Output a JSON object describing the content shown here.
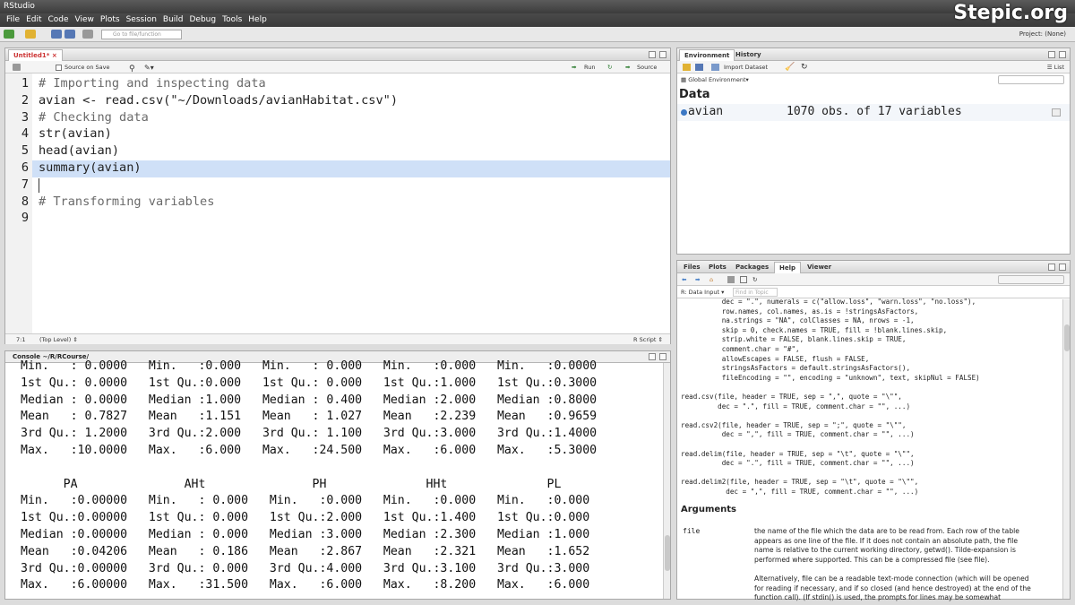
{
  "app": {
    "title": "RStudio",
    "brand": "Stepic.org"
  },
  "menu": [
    "File",
    "Edit",
    "Code",
    "View",
    "Plots",
    "Session",
    "Build",
    "Debug",
    "Tools",
    "Help"
  ],
  "toolbar": {
    "goto_placeholder": "Go to file/function",
    "project": "Project: (None)"
  },
  "editor": {
    "tab": "Untitled1*",
    "source_on_save": "Source on Save",
    "run": "Run",
    "source": "Source",
    "lines": [
      {
        "n": "1",
        "text": "# Importing and inspecting data",
        "kind": "comment"
      },
      {
        "n": "2",
        "text": "avian <- read.csv(\"~/Downloads/avianHabitat.csv\")",
        "kind": "code"
      },
      {
        "n": "3",
        "text": "# Checking data",
        "kind": "comment"
      },
      {
        "n": "4",
        "text": "str(avian)",
        "kind": "code"
      },
      {
        "n": "5",
        "text": "head(avian)",
        "kind": "code"
      },
      {
        "n": "6",
        "text": "summary(avian)",
        "kind": "code"
      },
      {
        "n": "7",
        "text": "",
        "kind": "code"
      },
      {
        "n": "8",
        "text": "# Transforming variables",
        "kind": "comment"
      },
      {
        "n": "9",
        "text": "",
        "kind": "code"
      }
    ],
    "status_pos": "7:1",
    "status_level": "(Top Level) ⇕",
    "status_type": "R Script ⇕"
  },
  "console": {
    "title": "Console ~/R/RCourse/",
    "lines": [
      "Min.   : 0.0000   Min.   :0.000   Min.   : 0.000   Min.   :0.000   Min.   :0.0000",
      "1st Qu.: 0.0000   1st Qu.:0.000   1st Qu.: 0.000   1st Qu.:1.000   1st Qu.:0.3000",
      "Median : 0.0000   Median :1.000   Median : 0.400   Median :2.000   Median :0.8000",
      "Mean   : 0.7827   Mean   :1.151   Mean   : 1.027   Mean   :2.239   Mean   :0.9659",
      "3rd Qu.: 1.2000   3rd Qu.:2.000   3rd Qu.: 1.100   3rd Qu.:3.000   3rd Qu.:1.4000",
      "Max.   :10.0000   Max.   :6.000   Max.   :24.500   Max.   :6.000   Max.   :5.3000",
      "",
      "      PA               AHt               PH              HHt              PL",
      "Min.   :0.00000   Min.   : 0.000   Min.   :0.000   Min.   :0.000   Min.   :0.000",
      "1st Qu.:0.00000   1st Qu.: 0.000   1st Qu.:2.000   1st Qu.:1.400   1st Qu.:0.000",
      "Median :0.00000   Median : 0.000   Median :3.000   Median :2.300   Median :1.000",
      "Mean   :0.04206   Mean   : 0.186   Mean   :2.867   Mean   :2.321   Mean   :1.652",
      "3rd Qu.:0.00000   3rd Qu.: 0.000   3rd Qu.:4.000   3rd Qu.:3.100   3rd Qu.:3.000",
      "Max.   :6.00000   Max.   :31.500   Max.   :6.000   Max.   :8.200   Max.   :6.000"
    ]
  },
  "environment": {
    "tabs": [
      "Environment",
      "History"
    ],
    "import": "Import Dataset",
    "list": "List",
    "scope": "Global Environment",
    "section": "Data",
    "rows": [
      {
        "name": "avian",
        "value": "1070 obs. of 17 variables"
      }
    ]
  },
  "files": {
    "tabs": [
      "Files",
      "Plots",
      "Packages",
      "Help",
      "Viewer"
    ],
    "topic": "R: Data Input",
    "find_placeholder": "Find in Topic",
    "code_lines": [
      "          dec = \".\", numerals = c(\"allow.loss\", \"warn.loss\", \"no.loss\"),",
      "          row.names, col.names, as.is = !stringsAsFactors,",
      "          na.strings = \"NA\", colClasses = NA, nrows = -1,",
      "          skip = 0, check.names = TRUE, fill = !blank.lines.skip,",
      "          strip.white = FALSE, blank.lines.skip = TRUE,",
      "          comment.char = \"#\",",
      "          allowEscapes = FALSE, flush = FALSE,",
      "          stringsAsFactors = default.stringsAsFactors(),",
      "          fileEncoding = \"\", encoding = \"unknown\", text, skipNul = FALSE)",
      "",
      "read.csv(file, header = TRUE, sep = \",\", quote = \"\\\"\",",
      "         dec = \".\", fill = TRUE, comment.char = \"\", ...)",
      "",
      "read.csv2(file, header = TRUE, sep = \";\", quote = \"\\\"\",",
      "          dec = \",\", fill = TRUE, comment.char = \"\", ...)",
      "",
      "read.delim(file, header = TRUE, sep = \"\\t\", quote = \"\\\"\",",
      "          dec = \".\", fill = TRUE, comment.char = \"\", ...)",
      "",
      "read.delim2(file, header = TRUE, sep = \"\\t\", quote = \"\\\"\",",
      "           dec = \",\", fill = TRUE, comment.char = \"\", ...)"
    ],
    "arguments_heading": "Arguments",
    "arg_name": "file",
    "arg_desc_lines": [
      "the name of the file which the data are to be read from. Each row of the table",
      "appears as one line of the file. If it does not contain an absolute path, the file",
      "name is relative to the current working directory, getwd(). Tilde-expansion is",
      "performed where supported. This can be a compressed file (see file).",
      "",
      "Alternatively, file can be a readable text-mode connection (which will be opened",
      "for reading if necessary, and if so closed (and hence destroyed) at the end of the",
      "function call). (If stdin() is used, the prompts for lines may be somewhat"
    ]
  }
}
